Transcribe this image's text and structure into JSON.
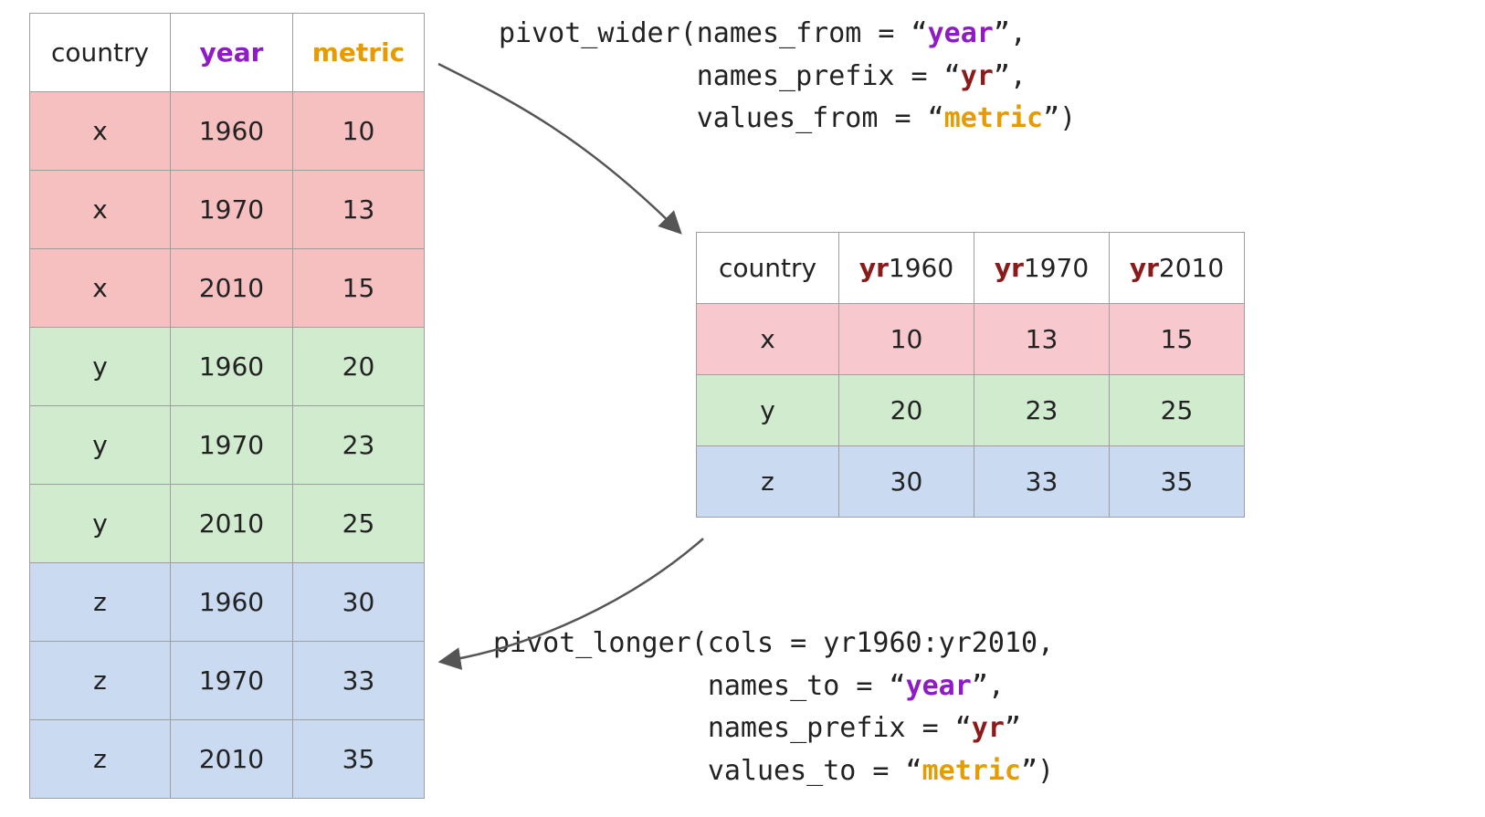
{
  "colors": {
    "purple": "#8f1bc7",
    "orange": "#e69b00",
    "darkred": "#8b1a1a",
    "pink_long": "#f6c0c1",
    "pink_wide": "#f7c9cf",
    "green": "#d0ebce",
    "blue": "#c9daf1"
  },
  "long_table": {
    "headers": {
      "country": "country",
      "year": "year",
      "metric": "metric"
    },
    "rows": [
      {
        "country": "x",
        "year": "1960",
        "metric": "10",
        "group": "pink"
      },
      {
        "country": "x",
        "year": "1970",
        "metric": "13",
        "group": "pink"
      },
      {
        "country": "x",
        "year": "2010",
        "metric": "15",
        "group": "pink"
      },
      {
        "country": "y",
        "year": "1960",
        "metric": "20",
        "group": "green"
      },
      {
        "country": "y",
        "year": "1970",
        "metric": "23",
        "group": "green"
      },
      {
        "country": "y",
        "year": "2010",
        "metric": "25",
        "group": "green"
      },
      {
        "country": "z",
        "year": "1960",
        "metric": "30",
        "group": "blue"
      },
      {
        "country": "z",
        "year": "1970",
        "metric": "33",
        "group": "blue"
      },
      {
        "country": "z",
        "year": "2010",
        "metric": "35",
        "group": "blue"
      }
    ]
  },
  "wide_table": {
    "headers": {
      "country": "country",
      "yr_prefix": "yr",
      "years": [
        "1960",
        "1970",
        "2010"
      ]
    },
    "rows": [
      {
        "country": "x",
        "v1": "10",
        "v2": "13",
        "v3": "15",
        "group": "pink2"
      },
      {
        "country": "y",
        "v1": "20",
        "v2": "23",
        "v3": "25",
        "group": "green"
      },
      {
        "country": "z",
        "v1": "30",
        "v2": "33",
        "v3": "35",
        "group": "blue"
      }
    ]
  },
  "code_wider": {
    "fn": "pivot_wider",
    "l1a": "pivot_wider(names_from = “",
    "l1b": "year",
    "l1c": "”,",
    "l2a": "names_prefix = “",
    "l2b": "yr",
    "l2c": "”,",
    "l3a": "values_from = “",
    "l3b": "metric",
    "l3c": "”)",
    "pad2": "            ",
    "pad3": "            "
  },
  "code_longer": {
    "fn": "pivot_longer",
    "l1": "pivot_longer(cols = yr1960:yr2010,",
    "l2a": "names_to = “",
    "l2b": "year",
    "l2c": "”,",
    "l3a": "names_prefix = “",
    "l3b": "yr",
    "l3c": "”",
    "l4a": "values_to = “",
    "l4b": "metric",
    "l4c": "”)",
    "pad": "             "
  }
}
